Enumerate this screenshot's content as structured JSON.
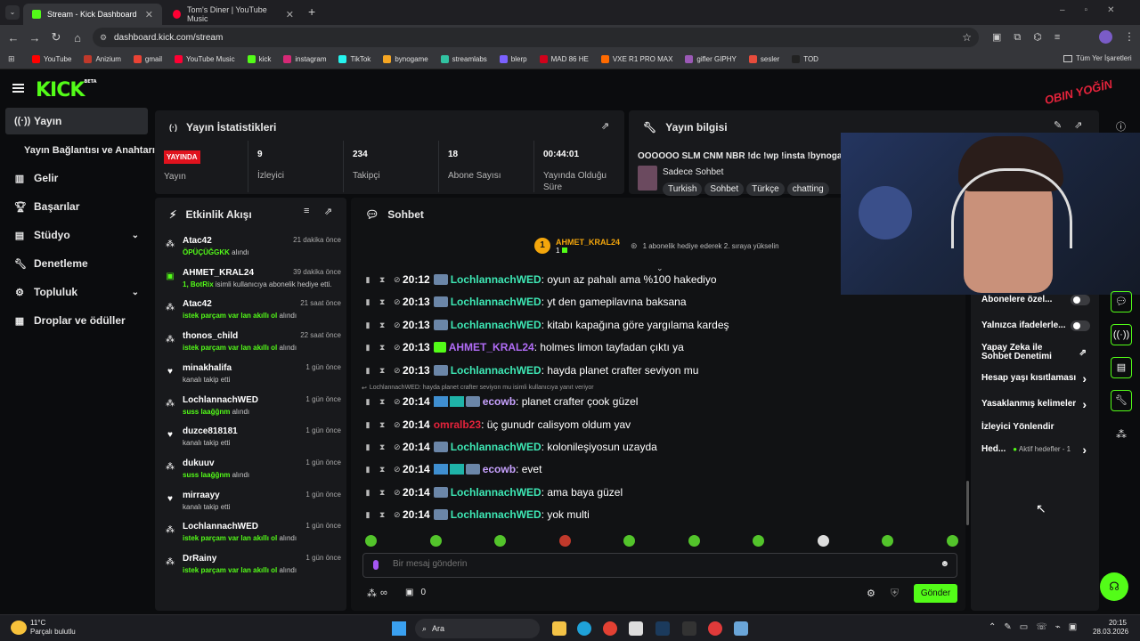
{
  "tabs": [
    {
      "label": "Stream - Kick Dashboard"
    },
    {
      "label": "Tom's Diner | YouTube Music"
    }
  ],
  "browser": {
    "url": "dashboard.kick.com/stream"
  },
  "bookmarks": [
    {
      "label": "YouTube",
      "color": "#ff0000"
    },
    {
      "label": "Anizium",
      "color": "#c0392b"
    },
    {
      "label": "gmail",
      "color": "#ea4335"
    },
    {
      "label": "YouTube Music",
      "color": "#ff0033"
    },
    {
      "label": "kick",
      "color": "#53fc18"
    },
    {
      "label": "instagram",
      "color": "#d62976"
    },
    {
      "label": "TikTok",
      "color": "#25f4ee"
    },
    {
      "label": "bynogame",
      "color": "#f5a623"
    },
    {
      "label": "streamlabs",
      "color": "#31c3a2"
    },
    {
      "label": "blerp",
      "color": "#7b61ff"
    },
    {
      "label": "MAD 86 HE",
      "color": "#d0021b"
    },
    {
      "label": "VXE R1 PRO MAX",
      "color": "#ff6a00"
    },
    {
      "label": "gifler GIPHY",
      "color": "#9b59b6"
    },
    {
      "label": "sesler",
      "color": "#e74c3c"
    },
    {
      "label": "TOD",
      "color": "#222222"
    }
  ],
  "bookmarks_folder": "Tüm Yer İşaretleri",
  "brand": {
    "logo": "KICK",
    "beta": "BETA",
    "accent": "#53fc18"
  },
  "sidebar": {
    "items": [
      {
        "label": "Yayın",
        "icon": "broadcast-icon"
      },
      {
        "label": "Yayın Bağlantısı ve Anahtarı"
      },
      {
        "label": "Gelir",
        "icon": "chart-icon"
      },
      {
        "label": "Başarılar",
        "icon": "trophy-icon"
      },
      {
        "label": "Stüdyo",
        "icon": "studio-icon"
      },
      {
        "label": "Denetleme",
        "icon": "wrench-icon"
      },
      {
        "label": "Topluluk",
        "icon": "community-icon"
      },
      {
        "label": "Droplar ve ödüller",
        "icon": "drops-icon"
      }
    ]
  },
  "stats": {
    "title": "Yayın İstatistikleri",
    "live_badge": "YAYINDA",
    "live_label": "Yayın",
    "items": [
      {
        "value": "9",
        "label": "İzleyici"
      },
      {
        "value": "234",
        "label": "Takipçi"
      },
      {
        "value": "18",
        "label": "Abone Sayısı"
      },
      {
        "value": "00:44:01",
        "label": "Yayında Olduğu Süre"
      }
    ]
  },
  "info": {
    "title": "Yayın bilgisi",
    "stream_title": "OOOOOO SLM CNM NBR !dc !wp !insta !bynogame",
    "category": "Sadece Sohbet",
    "tags": [
      "Turkish",
      "Sohbet",
      "Türkçe",
      "chatting"
    ]
  },
  "activity": {
    "title": "Etkinlik Akışı",
    "items": [
      {
        "name": "Atac42",
        "time": "21 dakika önce",
        "detail_strong": "ÖPÜÇÜĞGKK",
        "detail": " alındı",
        "icon": "drop-icon"
      },
      {
        "name": "AHMET_KRAL24",
        "time": "39 dakika önce",
        "detail_strong": "1, BotRix",
        "detail": " isimli kullanıcıya abonelik hediye etti.",
        "icon": "gift-icon"
      },
      {
        "name": "Atac42",
        "time": "21 saat önce",
        "detail_strong": "istek parçam var lan akıllı ol",
        "detail": " alındı",
        "icon": "drop-icon"
      },
      {
        "name": "thonos_child",
        "time": "22 saat önce",
        "detail_strong": "istek parçam var lan akıllı ol",
        "detail": " alındı",
        "icon": "drop-icon"
      },
      {
        "name": "minakhalifa",
        "time": "1 gün önce",
        "detail_strong": "",
        "detail": "kanalı takip etti",
        "icon": "heart-icon"
      },
      {
        "name": "LochlannachWED",
        "time": "1 gün önce",
        "detail_strong": "suss laağğnm",
        "detail": " alındı",
        "icon": "drop-icon"
      },
      {
        "name": "duzce818181",
        "time": "1 gün önce",
        "detail_strong": "",
        "detail": "kanalı takip etti",
        "icon": "heart-icon"
      },
      {
        "name": "dukuuv",
        "time": "1 gün önce",
        "detail_strong": "suss laağğnm",
        "detail": " alındı",
        "icon": "drop-icon"
      },
      {
        "name": "mirraayy",
        "time": "1 gün önce",
        "detail_strong": "",
        "detail": "kanalı takip etti",
        "icon": "heart-icon"
      },
      {
        "name": "LochlannachWED",
        "time": "1 gün önce",
        "detail_strong": "istek parçam var lan akıllı ol",
        "detail": " alındı",
        "icon": "drop-icon"
      },
      {
        "name": "DrRainy",
        "time": "1 gün önce",
        "detail_strong": "istek parçam var lan akıllı ol",
        "detail": " alındı",
        "icon": "drop-icon"
      }
    ]
  },
  "chat": {
    "title": "Sohbet",
    "pinned": {
      "rank": "1",
      "user": "AHMET_KRAL24",
      "count": "1",
      "text": "1 abonelik hediye ederek 2. sıraya yükselin"
    },
    "messages": [
      {
        "time": "20:12",
        "user": "LochlannachWED",
        "color": "#3ee8b5",
        "text": ": oyun az pahalı ama %100 hakediyo",
        "badge": "avatar"
      },
      {
        "time": "20:13",
        "user": "LochlannachWED",
        "color": "#3ee8b5",
        "text": ": yt den gamepilavına baksana",
        "badge": "avatar"
      },
      {
        "time": "20:13",
        "user": "LochlannachWED",
        "color": "#3ee8b5",
        "text": ": kitabı kapağına göre yargılama kardeş",
        "badge": "avatar"
      },
      {
        "time": "20:13",
        "user": "AHMET_KRAL24",
        "color": "#b16cf6",
        "text": ": holmes limon tayfadan çıktı ya",
        "badge": "gift"
      },
      {
        "time": "20:13",
        "user": "LochlannachWED",
        "color": "#3ee8b5",
        "text": ": hayda planet crafter seviyon mu",
        "badge": "avatar"
      },
      {
        "time": "20:14",
        "user": "ecowb",
        "color": "#c8a2ff",
        "text": ": planet crafter çook güzel",
        "badge": "triple"
      },
      {
        "time": "20:14",
        "user": "omralb23",
        "color": "#e5233b",
        "text": ": üç gunudr calisyom oldum yav",
        "badge": "none"
      },
      {
        "time": "20:14",
        "user": "LochlannachWED",
        "color": "#3ee8b5",
        "text": ": kolonileşiyosun uzayda",
        "badge": "avatar"
      },
      {
        "time": "20:14",
        "user": "ecowb",
        "color": "#c8a2ff",
        "text": ": evet",
        "badge": "triple"
      },
      {
        "time": "20:14",
        "user": "LochlannachWED",
        "color": "#3ee8b5",
        "text": ": ama baya güzel",
        "badge": "avatar"
      },
      {
        "time": "20:14",
        "user": "LochlannachWED",
        "color": "#3ee8b5",
        "text": ": yok multi",
        "badge": "avatar"
      }
    ],
    "reply_note": "LochlannachWED: hayda planet crafter seviyon mu isimli kullanıcıya yanıt veriyor",
    "input_placeholder": "Bir mesaj gönderin",
    "points": "∞",
    "inventory_count": "0",
    "send_label": "Gönder"
  },
  "settings": {
    "items": [
      {
        "label": "Abonelere özel...",
        "type": "toggle"
      },
      {
        "label": "Yalnızca ifadelerle...",
        "type": "toggle"
      },
      {
        "label": "Yapay Zeka ile Sohbet Denetimi",
        "type": "external"
      },
      {
        "label": "Hesap yaşı kısıtlaması",
        "type": "chevron"
      },
      {
        "label": "Yasaklanmış kelimeler",
        "type": "chevron"
      },
      {
        "label": "İzleyici Yönlendir",
        "type": "none"
      },
      {
        "label": "Hed...",
        "type": "chevron",
        "extra": "Aktif hedefler - 1"
      }
    ]
  },
  "overlay_text": "OBIN YOĞİN",
  "taskbar": {
    "weather_temp": "11°C",
    "weather_desc": "Parçalı bulutlu",
    "search": "Ara",
    "time": "20:15",
    "date": "28.03.2026"
  }
}
